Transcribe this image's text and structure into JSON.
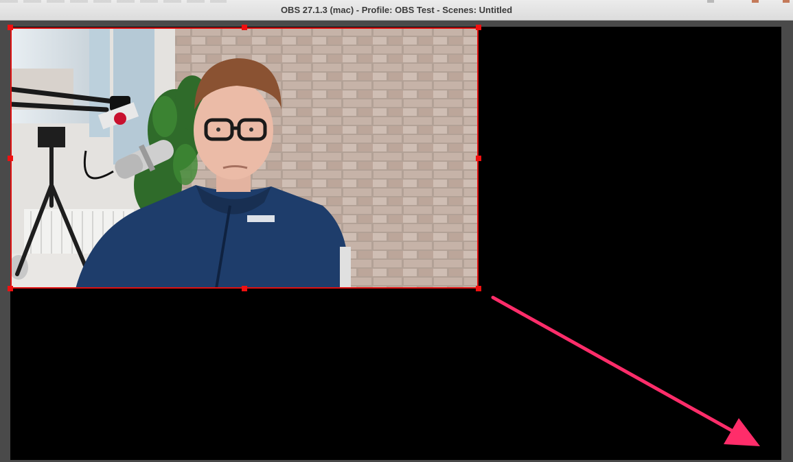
{
  "window": {
    "title": "OBS 27.1.3 (mac) - Profile: OBS Test - Scenes: Untitled"
  },
  "preview": {
    "source_kind": "video capture source",
    "selection_color": "#e01010",
    "canvas_color": "#000000"
  },
  "annotation": {
    "arrow_color": "#ff2d6a"
  },
  "icons": [
    "webcam-feed-image",
    "selection-handle",
    "annotation-arrow"
  ]
}
